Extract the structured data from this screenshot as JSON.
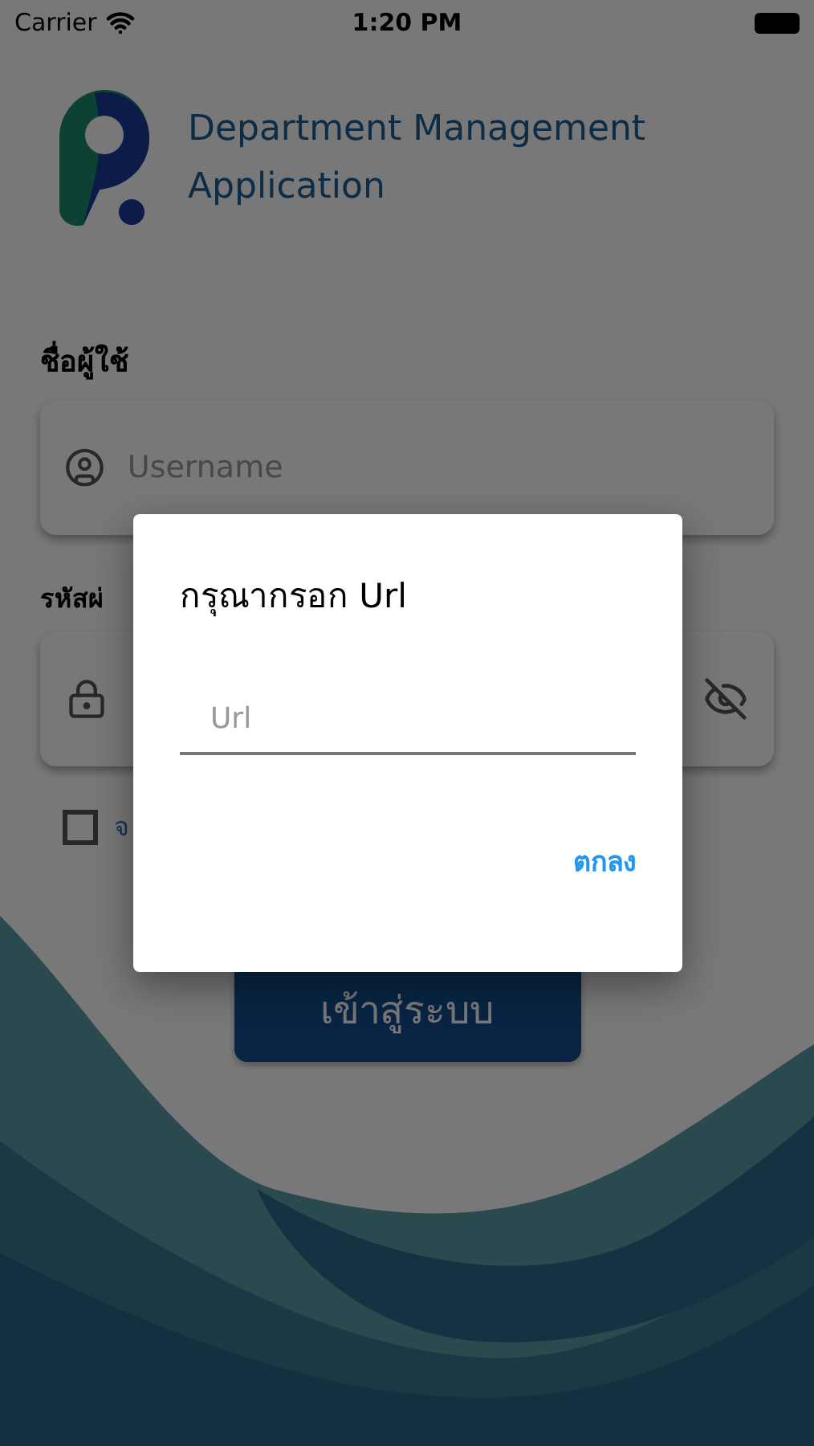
{
  "status_bar": {
    "carrier": "Carrier",
    "time": "1:20 PM"
  },
  "app": {
    "title_lines": [
      "Department Management",
      "Application"
    ]
  },
  "username": {
    "label": "ชื่อผู้ใช้",
    "placeholder": "Username"
  },
  "password": {
    "label": "รหัสผ่",
    "visible": false
  },
  "remember": {
    "label": "จ",
    "checked": false
  },
  "login_button": "เข้าสู่ระบบ",
  "dialog": {
    "title": "กรุณากรอก Url",
    "placeholder": "Url",
    "confirm": "ตกลง"
  }
}
